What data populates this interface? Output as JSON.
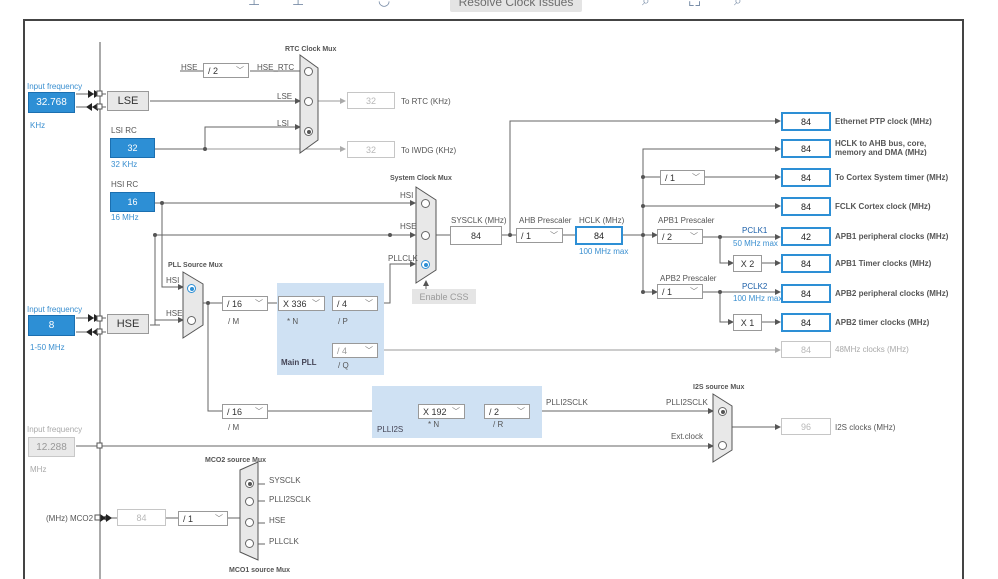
{
  "toolbar": {
    "resolve_label": "Resolve Clock Issues"
  },
  "lse": {
    "input_label": "Input frequency",
    "input_value": "32.768",
    "unit": "KHz",
    "source_label": "LSE"
  },
  "lsi": {
    "title": "LSI RC",
    "value": "32",
    "freq": "32 KHz"
  },
  "hsi": {
    "title": "HSI RC",
    "value": "16",
    "freq": "16 MHz"
  },
  "hse": {
    "input_label": "Input frequency",
    "input_value": "8",
    "range": "1-50 MHz",
    "source_label": "HSE"
  },
  "i2s_ext": {
    "input_label": "Input frequency",
    "input_value": "12.288",
    "unit": "MHz"
  },
  "rtc": {
    "mux_title": "RTC Clock Mux",
    "hse_label": "HSE",
    "hse_div": "/ 2",
    "hse_rtc_label": "HSE_RTC",
    "lse_label": "LSE",
    "lsi_label": "LSI",
    "rtc_value": "32",
    "rtc_label": "To RTC (KHz)",
    "iwdg_value": "32",
    "iwdg_label": "To IWDG (KHz)"
  },
  "sysclk_mux": {
    "title": "System Clock Mux",
    "hsi": "HSI",
    "hse": "HSE",
    "pllclk": "PLLCLK",
    "enable_css": "Enable CSS"
  },
  "sysclk": {
    "label": "SYSCLK (MHz)",
    "value": "84"
  },
  "ahb": {
    "label": "AHB Prescaler",
    "value": "/ 1"
  },
  "hclk": {
    "label": "HCLK (MHz)",
    "value": "84",
    "max": "100 MHz max"
  },
  "apb1": {
    "label": "APB1 Prescaler",
    "value": "/ 2",
    "pclk_label": "PCLK1",
    "pclk_max": "50 MHz max",
    "timer_mult": "X 2"
  },
  "apb2": {
    "label": "APB2 Prescaler",
    "value": "/ 1",
    "pclk_label": "PCLK2",
    "pclk_max": "100 MHz max",
    "timer_mult": "X 1"
  },
  "cortex_div": "/ 1",
  "pll_source": {
    "title": "PLL Source Mux",
    "hsi": "HSI",
    "hse": "HSE"
  },
  "main_pll": {
    "label": "Main PLL",
    "m_value": "/ 16",
    "m_label": "/ M",
    "n_value": "X 336",
    "n_label": "* N",
    "p_value": "/ 4",
    "p_label": "/ P",
    "q_value": "/ 4",
    "q_label": "/ Q"
  },
  "plli2s": {
    "label": "PLLI2S",
    "m_value": "/ 16",
    "m_label": "/ M",
    "n_value": "X 192",
    "n_label": "* N",
    "r_value": "/ 2",
    "r_label": "/ R",
    "out_label": "PLLI2SCLK"
  },
  "i2s_mux": {
    "title": "I2S source Mux",
    "plli2sclk": "PLLI2SCLK",
    "ext_clock": "Ext.clock",
    "value": "96",
    "label": "I2S clocks (MHz)"
  },
  "usb48": {
    "value": "84",
    "label": "48MHz clocks (MHz)"
  },
  "mco": {
    "mco2_title": "MCO2 source Mux",
    "mco1_title": "MCO1 source Mux",
    "options": [
      "SYSCLK",
      "PLLI2SCLK",
      "HSE",
      "PLLCLK"
    ],
    "output_label": "(MHz) MCO2",
    "output_value": "84",
    "div": "/ 1"
  },
  "outputs": [
    {
      "value": "84",
      "label": "Ethernet PTP clock (MHz)"
    },
    {
      "value": "84",
      "label": "HCLK to AHB bus, core, memory and DMA (MHz)"
    },
    {
      "value": "84",
      "label": "To Cortex System timer (MHz)"
    },
    {
      "value": "84",
      "label": "FCLK Cortex clock (MHz)"
    },
    {
      "value": "42",
      "label": "APB1 peripheral clocks (MHz)"
    },
    {
      "value": "84",
      "label": "APB1 Timer clocks (MHz)"
    },
    {
      "value": "84",
      "label": "APB2 peripheral clocks (MHz)"
    },
    {
      "value": "84",
      "label": "APB2 timer clocks (MHz)"
    }
  ],
  "colors": {
    "accent": "#2d8fd5",
    "pll_region": "#cfe1f3"
  }
}
